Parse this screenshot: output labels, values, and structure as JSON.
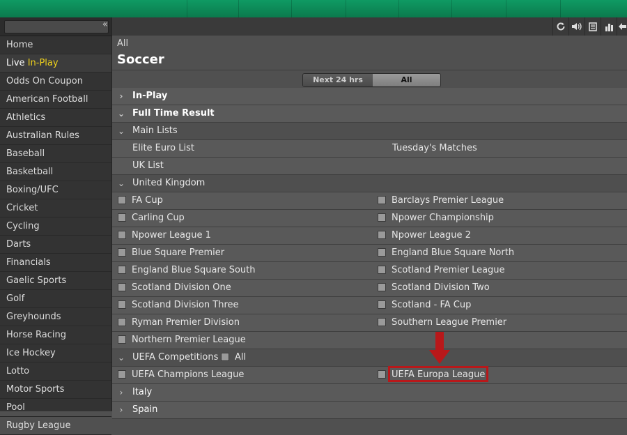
{
  "sidebar": {
    "items": [
      {
        "label": "Home"
      },
      {
        "label": "Live ",
        "highlight": "In-Play"
      },
      {
        "label": "Odds On Coupon"
      },
      {
        "label": "American Football"
      },
      {
        "label": "Athletics"
      },
      {
        "label": "Australian Rules"
      },
      {
        "label": "Baseball"
      },
      {
        "label": "Basketball"
      },
      {
        "label": "Boxing/UFC"
      },
      {
        "label": "Cricket"
      },
      {
        "label": "Cycling"
      },
      {
        "label": "Darts"
      },
      {
        "label": "Financials"
      },
      {
        "label": "Gaelic Sports"
      },
      {
        "label": "Golf"
      },
      {
        "label": "Greyhounds"
      },
      {
        "label": "Horse Racing"
      },
      {
        "label": "Ice Hockey"
      },
      {
        "label": "Lotto"
      },
      {
        "label": "Motor Sports"
      },
      {
        "label": "Pool"
      },
      {
        "label": "Rugby League"
      }
    ]
  },
  "header": {
    "breadcrumb": "All",
    "title": "Soccer"
  },
  "filter": {
    "next24": "Next 24 hrs",
    "all": "All",
    "selected": "All"
  },
  "sections": {
    "in_play": "In-Play",
    "full_time_result": "Full Time Result",
    "main_lists": "Main Lists",
    "elite_euro": "Elite Euro List",
    "tuesday": "Tuesday's Matches",
    "uk_list": "UK List",
    "united_kingdom": "United Kingdom",
    "uefa": "UEFA Competitions",
    "uefa_all": "All",
    "italy": "Italy",
    "spain": "Spain"
  },
  "uk_leagues": [
    [
      "FA Cup",
      "Barclays Premier League"
    ],
    [
      "Carling Cup",
      "Npower Championship"
    ],
    [
      "Npower League 1",
      "Npower League 2"
    ],
    [
      "Blue Square Premier",
      "England Blue Square North"
    ],
    [
      "England Blue Square South",
      "Scotland Premier League"
    ],
    [
      "Scotland Division One",
      "Scotland Division Two"
    ],
    [
      "Scotland Division Three",
      "Scotland - FA Cup"
    ],
    [
      "Ryman Premier Division",
      "Southern League Premier"
    ],
    [
      "Northern Premier League",
      ""
    ]
  ],
  "uefa_leagues": [
    "UEFA Champions League",
    "UEFA Europa League"
  ],
  "colors": {
    "brand": "#0f9a63",
    "active_tab": "#f4e53a",
    "highlight": "#b8181a",
    "live_text": "#f0d21c"
  },
  "icons": [
    "refresh-icon",
    "sound-icon",
    "betslip-icon",
    "stats-icon",
    "back-icon"
  ]
}
